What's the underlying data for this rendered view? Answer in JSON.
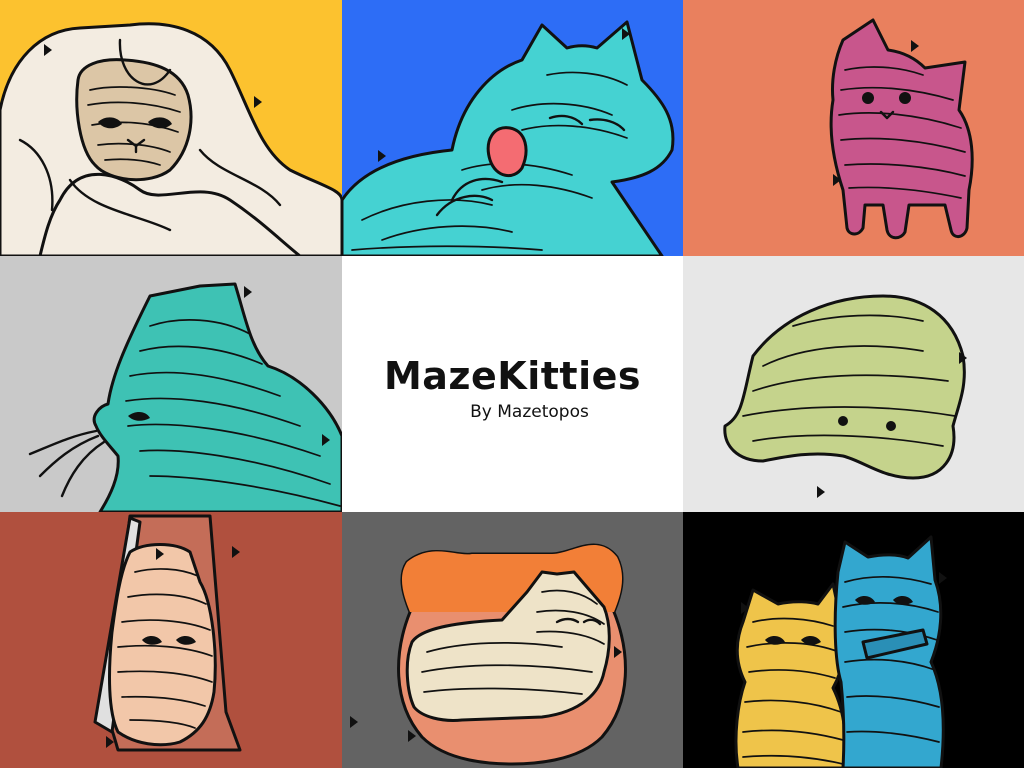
{
  "title": "MazeKitties",
  "subtitle": "By Mazetopos",
  "tiles": [
    {
      "name": "tile-kitten-in-blanket",
      "background": "#fcc22f",
      "fill": "#dcc6a6"
    },
    {
      "name": "tile-kitten-licking",
      "background": "#2d6df6",
      "fill": "#45d2d2"
    },
    {
      "name": "tile-kitten-sitting",
      "background": "#e9805e",
      "fill": "#c8568c"
    },
    {
      "name": "tile-cat-profile",
      "background": "#c9c9c9",
      "fill": "#3ec2b4"
    },
    {
      "name": "tile-title",
      "background": "#ffffff"
    },
    {
      "name": "tile-kitten-upside-down",
      "background": "#e7e7e7",
      "fill": "#c5d38c"
    },
    {
      "name": "tile-kitten-in-book",
      "background": "#b0503e",
      "fill": "#f2c7a9"
    },
    {
      "name": "tile-kitten-lying",
      "background": "#636363",
      "fill": "#eee3c8"
    },
    {
      "name": "tile-two-kittens",
      "background": "#000000",
      "fill": "#efc44a"
    }
  ]
}
